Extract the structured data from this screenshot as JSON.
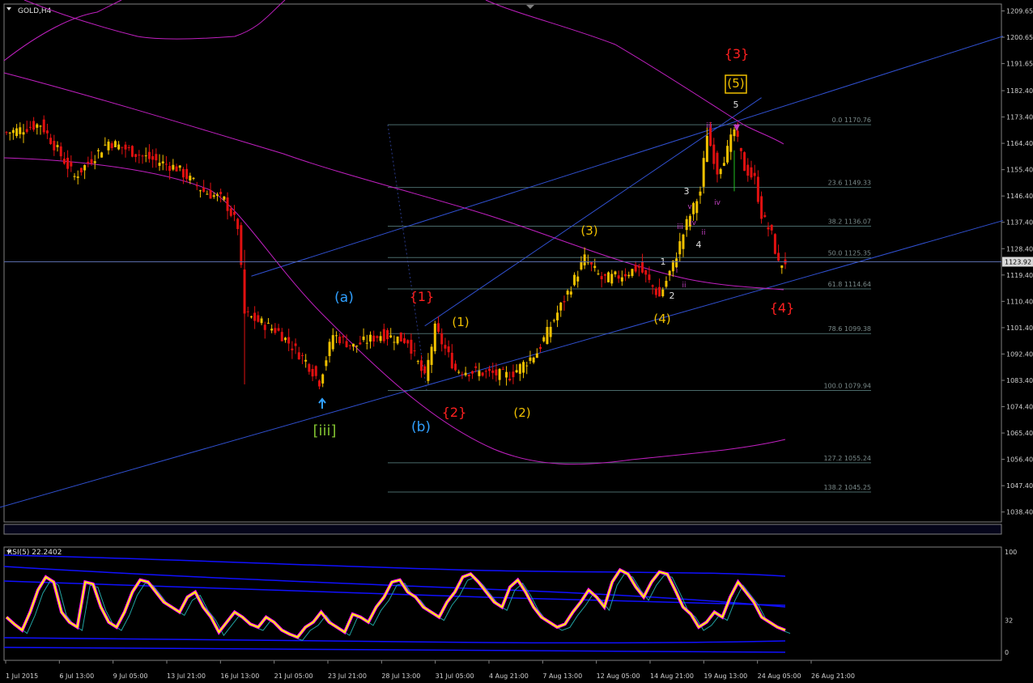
{
  "window": {
    "symbol_label": "GOLD,H4"
  },
  "indicator": {
    "title": "RSI(5) 22.2402"
  },
  "colors": {
    "background": "#000000",
    "bull": "#f0c000",
    "bear": "#e01010",
    "ma": "#c020c0",
    "trendline": "#3050d0",
    "fib": "#4a6a6a",
    "rsi": "#ffff00",
    "rsi_shadow": "#ff00ff",
    "band": "#1010ff",
    "current_price_line": "#5a6aa8",
    "grid": "#808080"
  },
  "chart_data": [
    {
      "type": "candlestick",
      "title": "GOLD,H4",
      "price_axis": {
        "labels": [
          "1209.65",
          "1200.65",
          "1191.65",
          "1182.40",
          "1173.40",
          "1164.40",
          "1155.40",
          "1146.40",
          "1137.40",
          "1128.40",
          "1119.40",
          "1110.40",
          "1101.40",
          "1092.40",
          "1083.40",
          "1074.40",
          "1065.40",
          "1056.40",
          "1047.40",
          "1038.40"
        ],
        "range": [
          1035,
          1212
        ]
      },
      "time_axis": {
        "labels": [
          "1 Jul 2015",
          "6 Jul 13:00",
          "9 Jul 05:00",
          "13 Jul 21:00",
          "16 Jul 13:00",
          "21 Jul 05:00",
          "23 Jul 21:00",
          "28 Jul 13:00",
          "31 Jul 05:00",
          "4 Aug 21:00",
          "7 Aug 13:00",
          "12 Aug 05:00",
          "14 Aug 21:00",
          "19 Aug 13:00",
          "24 Aug 05:00",
          "26 Aug 21:00"
        ]
      },
      "current_price": "1123.92",
      "key_prices": [
        {
          "bar": 0,
          "price": 1168
        },
        {
          "bar": 10,
          "price": 1171
        },
        {
          "bar": 20,
          "price": 1153
        },
        {
          "bar": 30,
          "price": 1165
        },
        {
          "bar": 40,
          "price": 1160
        },
        {
          "bar": 50,
          "price": 1156
        },
        {
          "bar": 58,
          "price": 1148
        },
        {
          "bar": 64,
          "price": 1145
        },
        {
          "bar": 68,
          "price": 1136
        },
        {
          "bar": 70,
          "price": 1106
        },
        {
          "bar": 80,
          "price": 1100
        },
        {
          "bar": 88,
          "price": 1090
        },
        {
          "bar": 92,
          "price": 1083
        },
        {
          "bar": 96,
          "price": 1099
        },
        {
          "bar": 102,
          "price": 1095
        },
        {
          "bar": 110,
          "price": 1099
        },
        {
          "bar": 118,
          "price": 1097
        },
        {
          "bar": 123,
          "price": 1084
        },
        {
          "bar": 126,
          "price": 1101
        },
        {
          "bar": 132,
          "price": 1087
        },
        {
          "bar": 140,
          "price": 1086
        },
        {
          "bar": 148,
          "price": 1085
        },
        {
          "bar": 156,
          "price": 1093
        },
        {
          "bar": 164,
          "price": 1111
        },
        {
          "bar": 170,
          "price": 1125
        },
        {
          "bar": 175,
          "price": 1118
        },
        {
          "bar": 180,
          "price": 1119
        },
        {
          "bar": 186,
          "price": 1122
        },
        {
          "bar": 192,
          "price": 1112
        },
        {
          "bar": 196,
          "price": 1123
        },
        {
          "bar": 200,
          "price": 1137
        },
        {
          "bar": 204,
          "price": 1148
        },
        {
          "bar": 206,
          "price": 1168
        },
        {
          "bar": 209,
          "price": 1155
        },
        {
          "bar": 212,
          "price": 1162
        },
        {
          "bar": 214,
          "price": 1169
        },
        {
          "bar": 217,
          "price": 1156
        },
        {
          "bar": 220,
          "price": 1152
        },
        {
          "bar": 222,
          "price": 1140
        },
        {
          "bar": 225,
          "price": 1133
        },
        {
          "bar": 227,
          "price": 1123
        },
        {
          "bar": 229,
          "price": 1124
        }
      ],
      "fibonacci": [
        {
          "level": "0.0",
          "price": "1170.76"
        },
        {
          "level": "23.6",
          "price": "1149.33"
        },
        {
          "level": "38.2",
          "price": "1136.07"
        },
        {
          "level": "50.0",
          "price": "1125.35"
        },
        {
          "level": "61.8",
          "price": "1114.64"
        },
        {
          "level": "78.6",
          "price": "1099.38"
        },
        {
          "level": "100.0",
          "price": "1079.94"
        },
        {
          "level": "127.2",
          "price": "1055.24"
        },
        {
          "level": "138.2",
          "price": "1045.25"
        }
      ],
      "wave_labels": [
        {
          "text": "{3}",
          "color": "#ff2020"
        },
        {
          "text": "(5)",
          "color": "#f0c000",
          "boxed": true
        },
        {
          "text": "5",
          "color": "#e0e0e0"
        },
        {
          "text": "iii",
          "color": "#c040c0"
        },
        {
          "text": "v",
          "color": "#c040c0"
        },
        {
          "text": "3",
          "color": "#e0e0e0"
        },
        {
          "text": "v",
          "color": "#c040c0"
        },
        {
          "text": "iv",
          "color": "#c040c0"
        },
        {
          "text": "iii",
          "color": "#c040c0"
        },
        {
          "text": "ii",
          "color": "#c040c0"
        },
        {
          "text": "iv",
          "color": "#c040c0"
        },
        {
          "text": "4",
          "color": "#e0e0e0"
        },
        {
          "text": "1",
          "color": "#e0e0e0"
        },
        {
          "text": "i",
          "color": "#c040c0"
        },
        {
          "text": "ii",
          "color": "#c040c0"
        },
        {
          "text": "2",
          "color": "#e0e0e0"
        },
        {
          "text": "(3)",
          "color": "#f0c000"
        },
        {
          "text": "(4)",
          "color": "#f0c000"
        },
        {
          "text": "{4}",
          "color": "#ff2020"
        },
        {
          "text": "(a)",
          "color": "#30a0ff"
        },
        {
          "text": "{1}",
          "color": "#ff2020"
        },
        {
          "text": "(1)",
          "color": "#f0c000"
        },
        {
          "text": "(2)",
          "color": "#f0c000"
        },
        {
          "text": "{2}",
          "color": "#ff2020"
        },
        {
          "text": "(b)",
          "color": "#30a0ff"
        },
        {
          "text": "[iii]",
          "color": "#80c030"
        }
      ]
    },
    {
      "type": "line",
      "title": "RSI(5) 22.2402",
      "y_axis": {
        "labels": [
          "100",
          "32",
          "0"
        ],
        "range": [
          0,
          100
        ]
      },
      "series": [
        {
          "name": "RSI(5)",
          "values": [
            35,
            28,
            22,
            40,
            62,
            75,
            70,
            40,
            30,
            25,
            70,
            68,
            45,
            30,
            25,
            40,
            60,
            72,
            70,
            60,
            50,
            45,
            40,
            55,
            60,
            45,
            35,
            20,
            30,
            40,
            35,
            28,
            25,
            35,
            30,
            22,
            18,
            15,
            25,
            30,
            40,
            30,
            25,
            20,
            38,
            35,
            30,
            45,
            55,
            70,
            72,
            60,
            55,
            45,
            40,
            35,
            50,
            60,
            75,
            78,
            70,
            60,
            50,
            45,
            65,
            72,
            60,
            45,
            35,
            30,
            25,
            28,
            40,
            50,
            62,
            55,
            45,
            70,
            82,
            78,
            65,
            55,
            70,
            80,
            78,
            62,
            45,
            38,
            25,
            30,
            40,
            35,
            55,
            70,
            60,
            50,
            35,
            30,
            25,
            22
          ]
        }
      ]
    }
  ]
}
